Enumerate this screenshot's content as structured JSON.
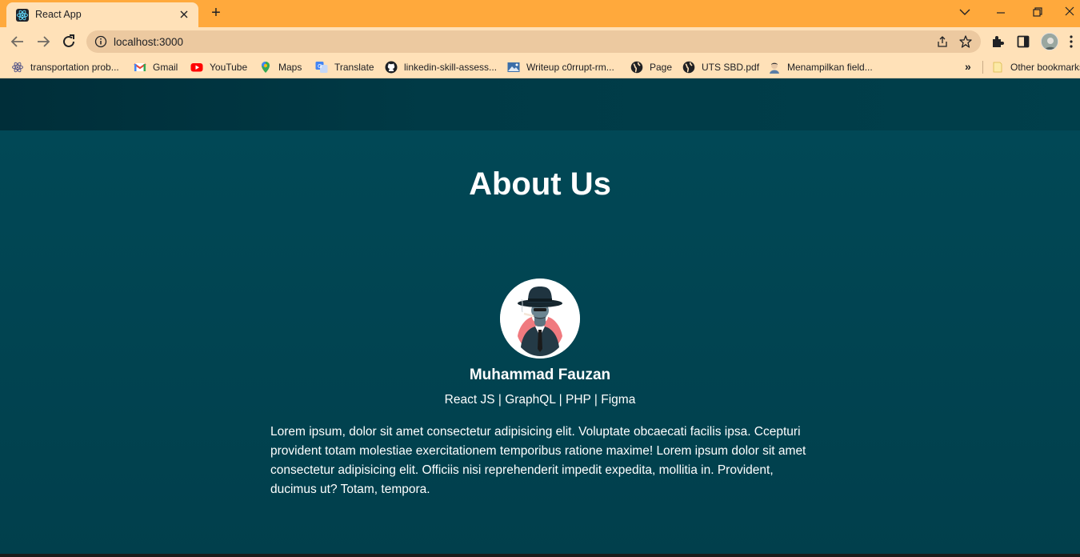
{
  "browser": {
    "tab": {
      "title": "React App",
      "favicon": "react-icon"
    },
    "new_tab_label": "+",
    "url": "localhost:3000",
    "accent_color": "#ffa93c",
    "toolbar_color": "#ffe1b8",
    "bookmarks": [
      {
        "label": "transportation prob...",
        "icon": "react-icon"
      },
      {
        "label": "Gmail",
        "icon": "gmail-icon"
      },
      {
        "label": "YouTube",
        "icon": "youtube-icon"
      },
      {
        "label": "Maps",
        "icon": "maps-icon"
      },
      {
        "label": "Translate",
        "icon": "translate-icon"
      },
      {
        "label": "linkedin-skill-assess...",
        "icon": "github-icon"
      },
      {
        "label": "Writeup c0rrupt-rm...",
        "icon": "image-icon"
      },
      {
        "label": "Page",
        "icon": "globe-icon"
      },
      {
        "label": "UTS SBD.pdf",
        "icon": "globe-icon"
      },
      {
        "label": "Menampilkan field...",
        "icon": "avatar-icon"
      }
    ],
    "more_bookmarks": "»",
    "other_bookmarks": "Other bookmarks"
  },
  "page": {
    "background_color": "#014957",
    "title": "About Us",
    "profile": {
      "name": "Muhammad Fauzan",
      "skills": "React JS | GraphQL | PHP | Figma",
      "bio": "Lorem ipsum, dolor sit amet consectetur adipisicing elit. Voluptate obcaecati facilis ipsa. Ccepturi provident totam molestiae exercitationem temporibus ratione maxime! Lorem ipsum dolor sit amet consectetur adipisicing elit. Officiis nisi reprehenderit impedit expedita, mollitia in. Provident, ducimus ut? Totam, tempora."
    }
  }
}
